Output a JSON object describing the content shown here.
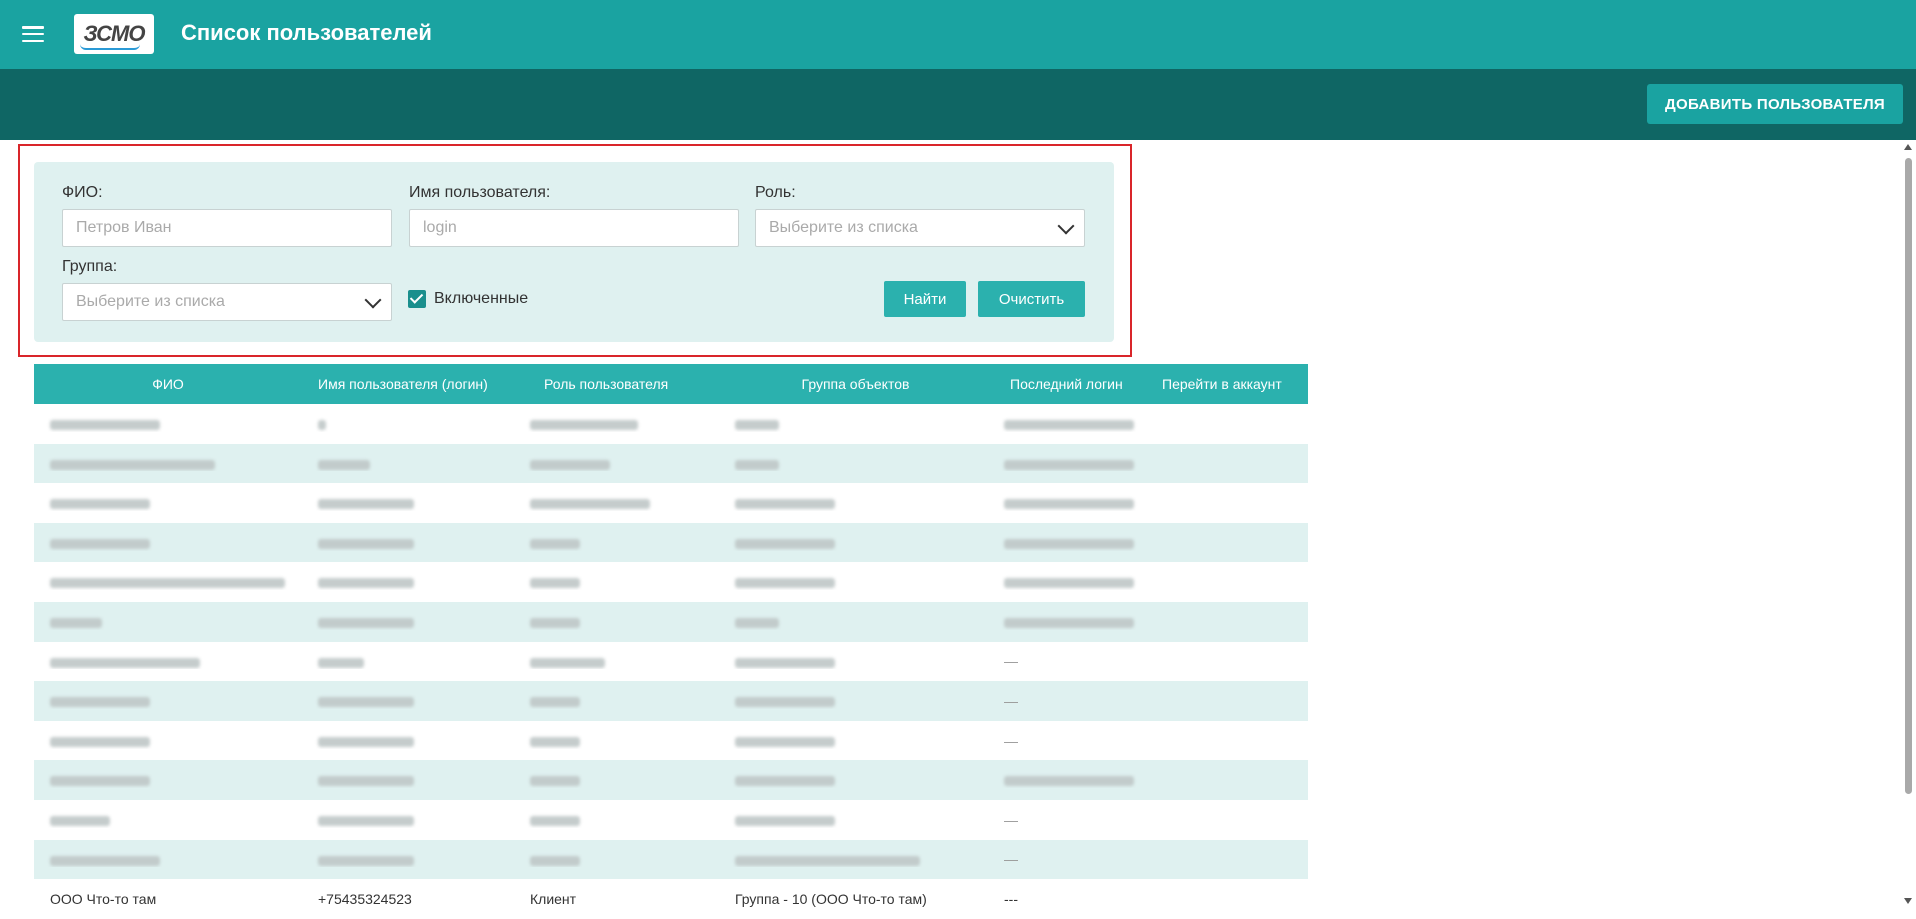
{
  "header": {
    "logo_text": "ЗСМО",
    "title": "Список пользователей",
    "menu_icon": "hamburger-menu-icon"
  },
  "subbar": {
    "add_button": "ДОБАВИТЬ ПОЛЬЗОВАТЕЛЯ"
  },
  "filters": {
    "fio_label": "ФИО:",
    "fio_placeholder": "Петров Иван",
    "username_label": "Имя пользователя:",
    "username_placeholder": "login",
    "role_label": "Роль:",
    "role_placeholder": "Выберите из списка",
    "group_label": "Группа:",
    "group_placeholder": "Выберите из списка",
    "enabled_label": "Включенные",
    "enabled_checked": true,
    "find_button": "Найти",
    "clear_button": "Очистить"
  },
  "table": {
    "columns": [
      "ФИО",
      "Имя пользователя (логин)",
      "Роль пользователя",
      "Группа объектов",
      "Последний логин",
      "Перейти в аккаунт"
    ],
    "last_row": {
      "fio": "ООО Что-то там",
      "login": "+75435324523",
      "role": "Клиент",
      "group": "Группа - 10 (ООО Что-то там)",
      "last_login": "---",
      "account": ""
    }
  },
  "colors": {
    "primary": "#1aa3a1",
    "primary_dark": "#0f6664",
    "panel_bg": "#dff1f0",
    "highlight": "#d9252a"
  }
}
